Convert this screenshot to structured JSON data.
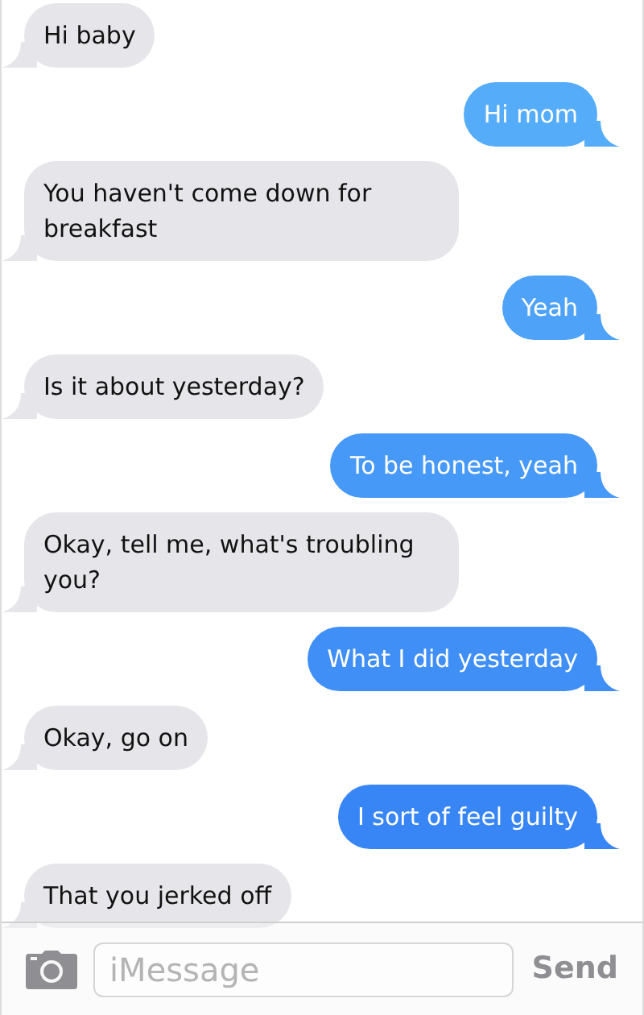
{
  "messages": [
    {
      "kind": "received",
      "text": "Hi baby"
    },
    {
      "kind": "sent",
      "text": "Hi mom"
    },
    {
      "kind": "received",
      "text": "You haven't come down for breakfast"
    },
    {
      "kind": "sent",
      "text": "Yeah"
    },
    {
      "kind": "received",
      "text": "Is it about yesterday?"
    },
    {
      "kind": "sent",
      "text": "To be honest, yeah"
    },
    {
      "kind": "received",
      "text": "Okay, tell me, what's troubling you?"
    },
    {
      "kind": "sent",
      "text": "What I did yesterday"
    },
    {
      "kind": "received",
      "text": "Okay, go on"
    },
    {
      "kind": "sent",
      "text": "I sort of feel guilty"
    },
    {
      "kind": "received",
      "text": "That you jerked off"
    }
  ],
  "composer": {
    "placeholder": "iMessage",
    "send": "Send"
  }
}
